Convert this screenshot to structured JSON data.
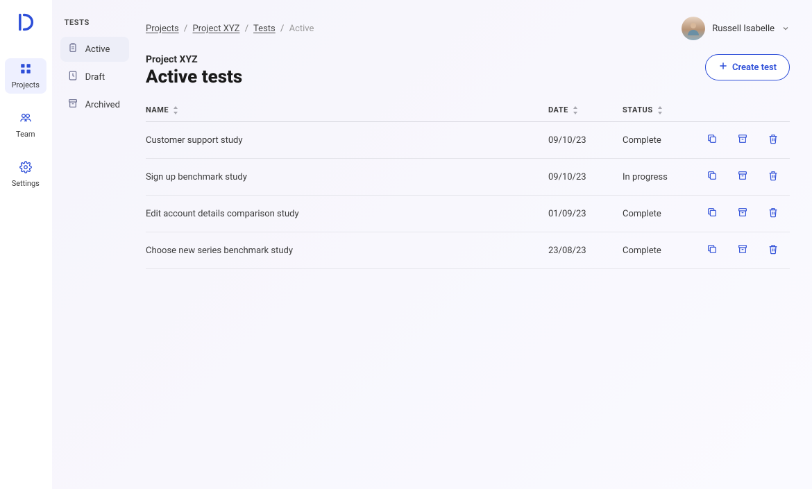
{
  "rail": {
    "items": [
      {
        "label": "Projects",
        "icon": "grid-icon",
        "active": true
      },
      {
        "label": "Team",
        "icon": "team-icon",
        "active": false
      },
      {
        "label": "Settings",
        "icon": "gear-icon",
        "active": false
      }
    ]
  },
  "sidebar": {
    "title": "TESTS",
    "items": [
      {
        "label": "Active",
        "icon": "clipboard-icon",
        "active": true
      },
      {
        "label": "Draft",
        "icon": "draft-icon",
        "active": false
      },
      {
        "label": "Archived",
        "icon": "archive-icon",
        "active": false
      }
    ]
  },
  "breadcrumbs": {
    "parts": [
      {
        "label": "Projects",
        "link": true
      },
      {
        "label": "Project XYZ",
        "link": true
      },
      {
        "label": "Tests",
        "link": true
      },
      {
        "label": "Active",
        "link": false
      }
    ]
  },
  "user": {
    "name": "Russell Isabelle"
  },
  "header": {
    "project_name": "Project XYZ",
    "page_title": "Active tests",
    "create_label": "Create test"
  },
  "columns": {
    "name": "NAME",
    "date": "DATE",
    "status": "STATUS"
  },
  "rows": [
    {
      "name": "Customer support study",
      "date": "09/10/23",
      "status": "Complete"
    },
    {
      "name": "Sign up benchmark study",
      "date": "09/10/23",
      "status": "In progress"
    },
    {
      "name": "Edit account details comparison study",
      "date": "01/09/23",
      "status": "Complete"
    },
    {
      "name": "Choose new series benchmark study",
      "date": "23/08/23",
      "status": "Complete"
    }
  ]
}
